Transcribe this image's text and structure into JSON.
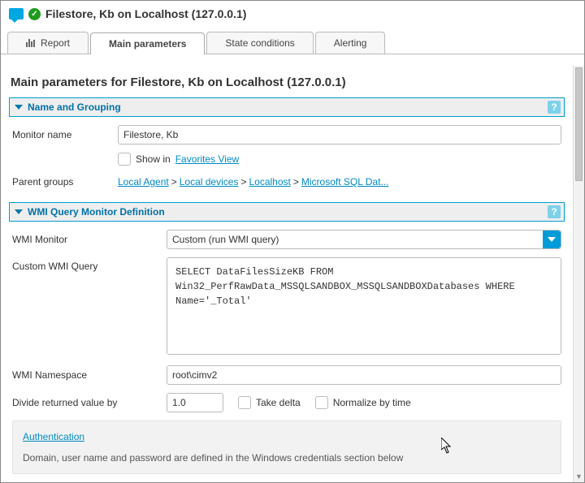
{
  "header": {
    "title": "Filestore, Kb on Localhost (127.0.0.1)"
  },
  "tabs": {
    "report": "Report",
    "main": "Main parameters",
    "state": "State conditions",
    "alerting": "Alerting"
  },
  "page": {
    "title": "Main parameters for Filestore, Kb on Localhost (127.0.0.1)"
  },
  "sections": {
    "name_grouping": {
      "title": "Name and Grouping",
      "monitor_name_label": "Monitor name",
      "monitor_name_value": "Filestore, Kb",
      "show_in_label": "Show in",
      "favorites_link": "Favorites View",
      "parent_groups_label": "Parent groups",
      "breadcrumb": {
        "a": "Local Agent",
        "b": "Local devices",
        "c": "Localhost",
        "d": "Microsoft SQL Dat..."
      }
    },
    "wmi_def": {
      "title": "WMI Query Monitor Definition",
      "wmi_monitor_label": "WMI Monitor",
      "wmi_monitor_value": "Custom (run WMI query)",
      "custom_query_label": "Custom WMI Query",
      "custom_query_value": "SELECT DataFilesSizeKB FROM Win32_PerfRawData_MSSQLSANDBOX_MSSQLSANDBOXDatabases WHERE Name='_Total'",
      "namespace_label": "WMI Namespace",
      "namespace_value": "root\\cimv2",
      "divide_label": "Divide returned value by",
      "divide_value": "1.0",
      "take_delta_label": "Take delta",
      "normalize_label": "Normalize by time"
    },
    "auth": {
      "title": "Authentication",
      "desc": "Domain, user name and password are defined in the Windows credentials section below"
    }
  }
}
